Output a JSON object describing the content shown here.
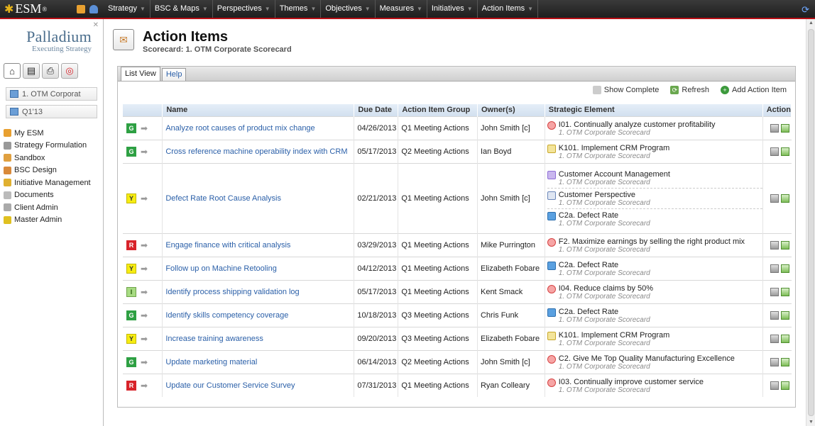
{
  "app": {
    "brand": "ESM",
    "brand_mark": "®",
    "colors": {
      "accent": "#b80f16",
      "link": "#2a5fa8",
      "header_bg": "#1e1e1e"
    }
  },
  "nav": [
    "Strategy",
    "BSC & Maps",
    "Perspectives",
    "Themes",
    "Objectives",
    "Measures",
    "Initiatives",
    "Action Items"
  ],
  "sidebar": {
    "logo_line1": "Palladium",
    "logo_line2": "Executing Strategy",
    "scorecard_box": "1. OTM Corporat",
    "period_box": "Q1'13",
    "menu": [
      "My ESM",
      "Strategy Formulation",
      "Sandbox",
      "BSC Design",
      "Initiative Management",
      "Documents",
      "Client Admin",
      "Master Admin"
    ]
  },
  "page": {
    "title": "Action Items",
    "subtitle": "Scorecard: 1. OTM Corporate Scorecard"
  },
  "tabs": [
    "List View",
    "Help"
  ],
  "toolbar": {
    "show_complete": "Show Complete",
    "refresh": "Refresh",
    "add": "Add Action Item"
  },
  "table": {
    "headers": [
      "",
      "Name",
      "Due Date",
      "Action Item Group",
      "Owner(s)",
      "Strategic Element",
      "Action"
    ],
    "rows": [
      {
        "status": "G",
        "name": "Analyze root causes of product mix change",
        "due": "04/26/2013",
        "group": "Q1 Meeting Actions",
        "owner": "John Smith [c]",
        "elements": [
          {
            "icon": "obj",
            "name": "I01. Continually analyze customer profitability",
            "sub": "1. OTM Corporate Scorecard"
          }
        ]
      },
      {
        "status": "G",
        "name": "Cross reference machine operability index with CRM",
        "due": "05/17/2013",
        "group": "Q2 Meeting Actions",
        "owner": "Ian Boyd",
        "elements": [
          {
            "icon": "init",
            "name": "K101. Implement CRM Program",
            "sub": "1. OTM Corporate Scorecard"
          }
        ]
      },
      {
        "status": "Y",
        "name": "Defect Rate Root Cause Analysis",
        "due": "02/21/2013",
        "group": "Q1 Meeting Actions",
        "owner": "John Smith [c]",
        "elements": [
          {
            "icon": "theme",
            "name": "Customer Account Management",
            "sub": "1. OTM Corporate Scorecard"
          },
          {
            "icon": "persp",
            "name": "Customer Perspective",
            "sub": "1. OTM Corporate Scorecard"
          },
          {
            "icon": "meas",
            "name": "C2a. Defect Rate",
            "sub": "1. OTM Corporate Scorecard"
          }
        ]
      },
      {
        "status": "R",
        "name": "Engage finance with critical analysis",
        "due": "03/29/2013",
        "group": "Q1 Meeting Actions",
        "owner": "Mike Purrington",
        "elements": [
          {
            "icon": "obj",
            "name": "F2. Maximize earnings by selling the right product mix",
            "sub": "1. OTM Corporate Scorecard"
          }
        ]
      },
      {
        "status": "Y",
        "name": "Follow up on Machine Retooling",
        "due": "04/12/2013",
        "group": "Q1 Meeting Actions",
        "owner": "Elizabeth Fobare",
        "elements": [
          {
            "icon": "meas",
            "name": "C2a. Defect Rate",
            "sub": "1. OTM Corporate Scorecard"
          }
        ]
      },
      {
        "status": "I",
        "name": "Identify process shipping validation log",
        "due": "05/17/2013",
        "group": "Q1 Meeting Actions",
        "owner": "Kent Smack",
        "elements": [
          {
            "icon": "obj",
            "name": "I04. Reduce claims by 50%",
            "sub": "1. OTM Corporate Scorecard"
          }
        ]
      },
      {
        "status": "G",
        "name": "Identify skills competency coverage",
        "due": "10/18/2013",
        "group": "Q3 Meeting Actions",
        "owner": "Chris Funk",
        "elements": [
          {
            "icon": "meas",
            "name": "C2a. Defect Rate",
            "sub": "1. OTM Corporate Scorecard"
          }
        ]
      },
      {
        "status": "Y",
        "name": "Increase training awareness",
        "due": "09/20/2013",
        "group": "Q3 Meeting Actions",
        "owner": "Elizabeth Fobare",
        "elements": [
          {
            "icon": "init",
            "name": "K101. Implement CRM Program",
            "sub": "1. OTM Corporate Scorecard"
          }
        ]
      },
      {
        "status": "G",
        "name": "Update marketing material",
        "due": "06/14/2013",
        "group": "Q2 Meeting Actions",
        "owner": "John Smith [c]",
        "elements": [
          {
            "icon": "obj",
            "name": "C2. Give Me Top Quality Manufacturing Excellence",
            "sub": "1. OTM Corporate Scorecard"
          }
        ]
      },
      {
        "status": "R",
        "name": "Update our Customer Service Survey",
        "due": "07/31/2013",
        "group": "Q1 Meeting Actions",
        "owner": "Ryan Colleary",
        "elements": [
          {
            "icon": "obj",
            "name": "I03. Continually improve customer service",
            "sub": "1. OTM Corporate Scorecard"
          }
        ]
      }
    ]
  }
}
